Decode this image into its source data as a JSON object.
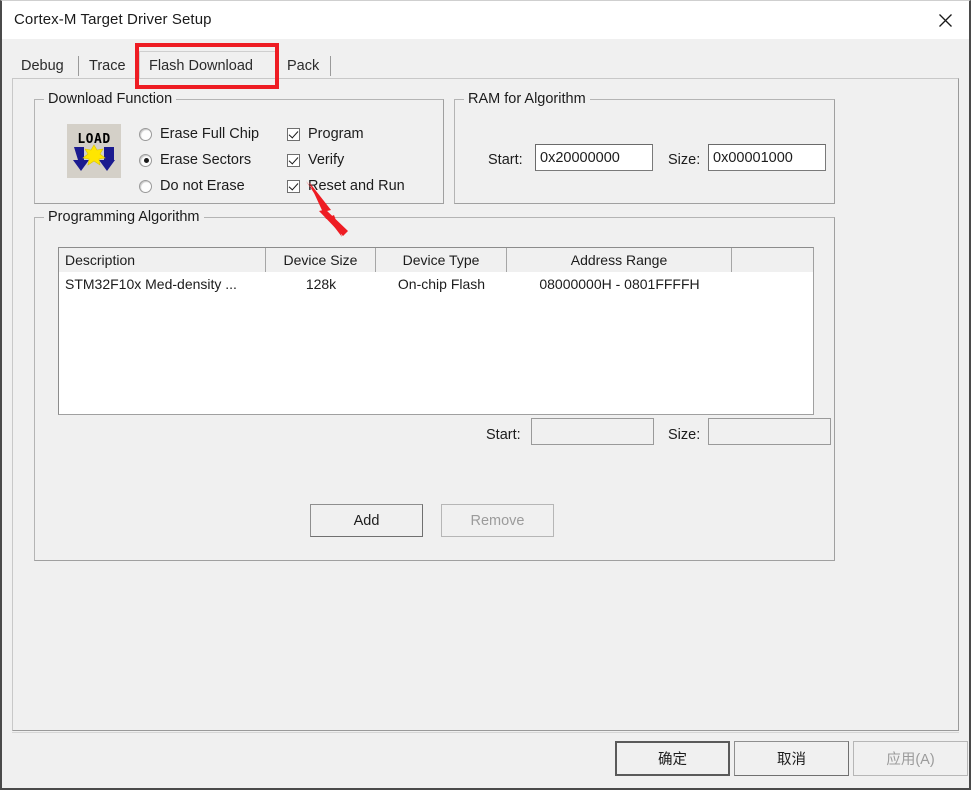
{
  "window": {
    "title": "Cortex-M Target Driver Setup",
    "close_icon": "close-icon"
  },
  "tabs": [
    {
      "label": "Debug",
      "active": false
    },
    {
      "label": "Trace",
      "active": false
    },
    {
      "label": "Flash Download",
      "active": true
    },
    {
      "label": "Pack",
      "active": false
    }
  ],
  "download_function": {
    "legend": "Download Function",
    "icon": "flash-load-icon",
    "radios": [
      {
        "label": "Erase Full Chip",
        "selected": false
      },
      {
        "label": "Erase Sectors",
        "selected": true
      },
      {
        "label": "Do not Erase",
        "selected": false
      }
    ],
    "checkboxes": [
      {
        "label": "Program",
        "checked": true
      },
      {
        "label": "Verify",
        "checked": true
      },
      {
        "label": "Reset and Run",
        "checked": true
      }
    ]
  },
  "ram_for_algorithm": {
    "legend": "RAM for Algorithm",
    "start_label": "Start:",
    "start_value": "0x20000000",
    "size_label": "Size:",
    "size_value": "0x00001000"
  },
  "programming_algorithm": {
    "legend": "Programming Algorithm",
    "columns": [
      "Description",
      "Device Size",
      "Device Type",
      "Address Range",
      ""
    ],
    "rows": [
      {
        "description": "STM32F10x Med-density ...",
        "device_size": "128k",
        "device_type": "On-chip Flash",
        "address_range": "08000000H - 0801FFFFH",
        "extra": ""
      }
    ],
    "start_label": "Start:",
    "start_value": "",
    "size_label": "Size:",
    "size_value": ""
  },
  "actions": {
    "add_label": "Add",
    "add_enabled": true,
    "remove_label": "Remove",
    "remove_enabled": false
  },
  "footer": {
    "ok_label": "确定",
    "cancel_label": "取消",
    "apply_label": "应用(A)",
    "apply_enabled": false
  },
  "annotations": {
    "highlight_color": "#ee1c23",
    "rect_target": "Flash Download",
    "arrow_target": "Reset and Run"
  }
}
